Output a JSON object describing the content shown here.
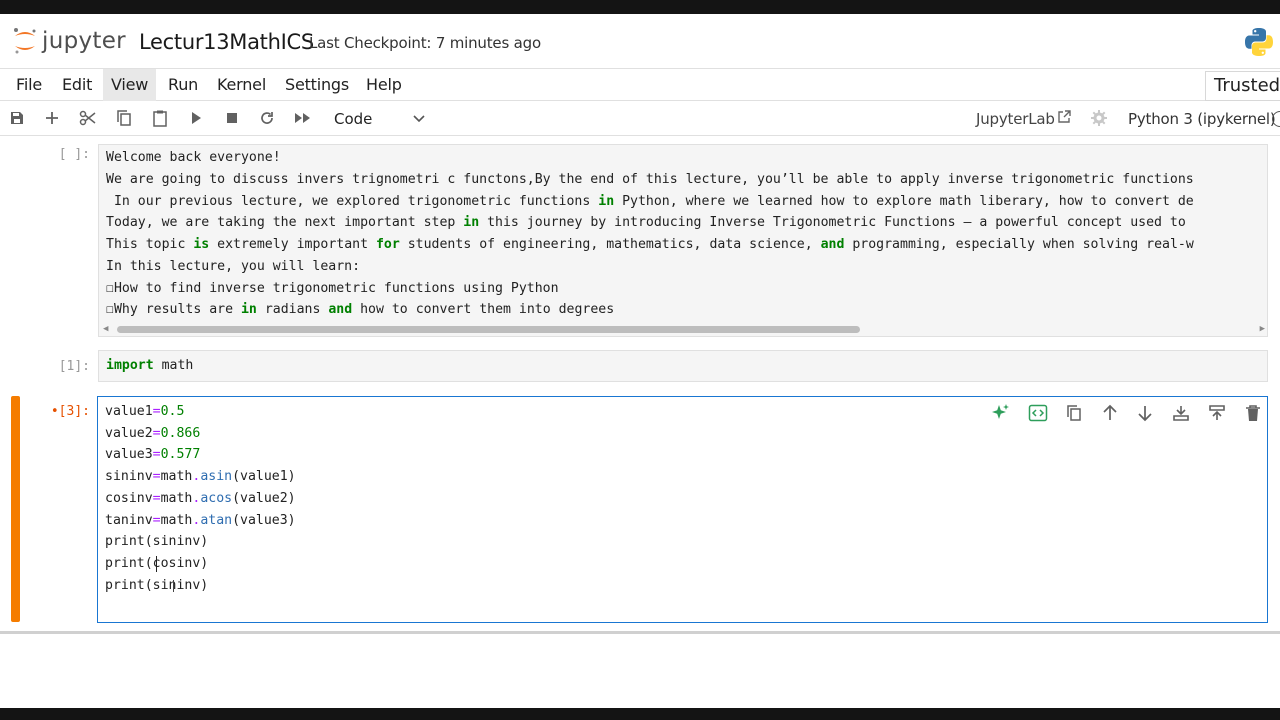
{
  "app": {
    "logo_text": "jupyter",
    "notebook_title": "Lectur13MathICS",
    "checkpoint": "Last Checkpoint: 7 minutes ago"
  },
  "menu": {
    "items": [
      {
        "label": "File"
      },
      {
        "label": "Edit"
      },
      {
        "label": "View"
      },
      {
        "label": "Run"
      },
      {
        "label": "Kernel"
      },
      {
        "label": "Settings"
      },
      {
        "label": "Help"
      }
    ],
    "trusted": "Trusted"
  },
  "toolbar": {
    "icons": [
      "save-icon",
      "add-icon",
      "cut-icon",
      "copy-icon",
      "paste-icon",
      "run-icon",
      "stop-icon",
      "restart-icon",
      "run-all-icon"
    ],
    "cell_type": "Code",
    "jupyterlab_link": "JupyterLab",
    "kernel_name": "Python 3 (ipykernel)"
  },
  "cells": {
    "markdown": {
      "prompt": "[ ]:",
      "lines": [
        "Welcome back everyone!",
        "We are going to discuss invers trignometri c functons,By the end of this lecture, you’ll be able to apply inverse trigonometric functions",
        " In our previous lecture, we explored trigonometric functions in Python, where we learned how to explore math liberary, how to convert de",
        "Today, we are taking the next important step in this journey by introducing Inverse Trigonometric Functions — a powerful concept used to",
        "This topic is extremely important for students of engineering, mathematics, data science, and programming, especially when solving real-w",
        "In this lecture, you will learn:",
        "☐How to find inverse trigonometric functions using Python",
        "☐Why results are in radians and how to convert them into degrees"
      ]
    },
    "import": {
      "prompt": "[1]:",
      "code": "import math"
    },
    "active": {
      "prompt": "•[3]:",
      "lines": [
        "value1=0.5",
        "value2=0.866",
        "value3=0.577",
        "sininv=math.asin(value1)",
        "cosinv=math.acos(value2)",
        "taninv=math.atan(value3)",
        "print(sininv)",
        "print(cosinv)",
        "print(sininv)"
      ],
      "cell_tools": [
        "ai-sparkle-icon",
        "format-code-icon",
        "duplicate-icon",
        "move-up-icon",
        "move-down-icon",
        "insert-above-icon",
        "insert-below-icon",
        "delete-icon"
      ]
    }
  },
  "colors": {
    "accent": "#1976d2",
    "active_bar": "#f57c00",
    "keyword": "#008000",
    "attribute": "#2f6db0"
  }
}
